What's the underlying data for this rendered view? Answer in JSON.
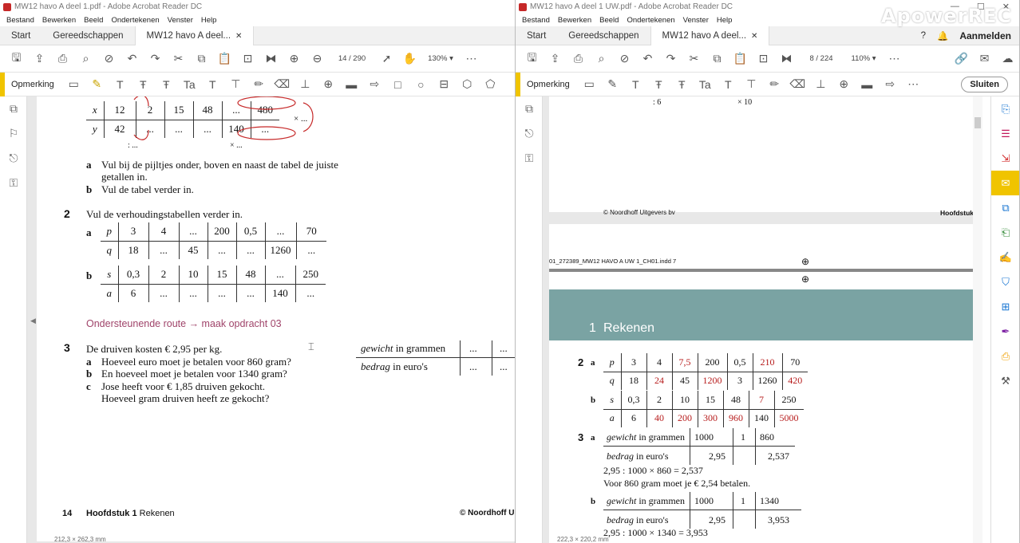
{
  "left": {
    "title": "MW12 havo A deel 1.pdf - Adobe Acrobat Reader DC",
    "menu": [
      "Bestand",
      "Bewerken",
      "Beeld",
      "Ondertekenen",
      "Venster",
      "Help"
    ],
    "tabs": {
      "home": "Start",
      "tools": "Gereedschappen",
      "doc": "MW12 havo A deel..."
    },
    "page_current": "14",
    "page_total": "/ 290",
    "zoom": "130%",
    "ann_label": "Opmerking",
    "content": {
      "above_arrow": ": ...",
      "t1": {
        "x": [
          "x",
          "12",
          "2",
          "15",
          "48",
          "...",
          "480"
        ],
        "y": [
          "y",
          "42",
          "...",
          "...",
          "...",
          "140",
          "..."
        ]
      },
      "t1_right": "× ...",
      "t1_below_left": ": ...",
      "t1_below_right": "× ...",
      "q1a_label": "a",
      "q1a": "Vul bij de pijltjes onder, boven en naast de tabel de juiste",
      "q1a2": "getallen in.",
      "q1b_label": "b",
      "q1b": "Vul de tabel verder in.",
      "q2_num": "2",
      "q2": "Vul de verhoudingstabellen verder in.",
      "q2a_label": "a",
      "t2a": {
        "r1": [
          "p",
          "3",
          "4",
          "...",
          "200",
          "0,5",
          "...",
          "70"
        ],
        "r2": [
          "q",
          "18",
          "...",
          "45",
          "...",
          "...",
          "1260",
          "..."
        ]
      },
      "q2b_label": "b",
      "t2b": {
        "r1": [
          "s",
          "0,3",
          "2",
          "10",
          "15",
          "48",
          "...",
          "250"
        ],
        "r2": [
          "a",
          "6",
          "...",
          "...",
          "...",
          "...",
          "140",
          "..."
        ]
      },
      "route": "Ondersteunende route → maak opdracht 03",
      "q3_num": "3",
      "q3": "De druiven kosten € 2,95 per kg.",
      "q3a_label": "a",
      "q3a": "Hoeveel euro moet je betalen voor 860 gram?",
      "q3b_label": "b",
      "q3b": "En hoeveel moet je betalen voor 1340 gram?",
      "q3c_label": "c",
      "q3c": "Jose heeft voor € 1,85 druiven gekocht.",
      "q3c2": "Hoeveel gram druiven heeft ze gekocht?",
      "gw_label_it": "gewicht",
      "gw_label": " in grammen",
      "bd_label_it": "bedrag",
      "bd_label": " in euro's",
      "dots": "...",
      "footer_num": "14",
      "footer_ch": "Hoofdstuk",
      "footer_ch_num": "1",
      "footer_ch_name": "Rekenen",
      "footer_right": "© Noordhoff Ui",
      "status": "212,3 × 262,3 mm"
    }
  },
  "right": {
    "title": "MW12 havo A deel 1 UW.pdf - Adobe Acrobat Reader DC",
    "menu": [
      "Bestand",
      "Bewerken",
      "Beeld",
      "Ondertekenen",
      "Venster",
      "Help"
    ],
    "tabs": {
      "home": "Start",
      "tools": "Gereedschappen",
      "doc": "MW12 havo A deel..."
    },
    "signin": "Aanmelden",
    "page_current": "8",
    "page_total": "/ 224",
    "zoom": "110%",
    "ann_label": "Opmerking",
    "close": "Sluiten",
    "content": {
      "top_left": ": 6",
      "top_right": "× 10",
      "copyright": "© Noordhoff Uitgevers bv",
      "chapter": "Hoofdstuk",
      "indd": "01_272389_MW12 HAVO A UW 1_CH01.indd   7",
      "banner_num": "1",
      "banner_title": "Rekenen",
      "a2_num": "2",
      "a2a": "a",
      "a2b": "b",
      "t2a": {
        "r1": [
          [
            "p",
            ""
          ],
          [
            "3",
            ""
          ],
          [
            "4",
            ""
          ],
          [
            "7,5",
            "red"
          ],
          [
            "200",
            ""
          ],
          [
            "0,5",
            ""
          ],
          [
            "210",
            "red"
          ],
          [
            "70",
            ""
          ]
        ],
        "r2": [
          [
            "q",
            ""
          ],
          [
            "18",
            ""
          ],
          [
            "24",
            "red"
          ],
          [
            "45",
            ""
          ],
          [
            "1200",
            "red"
          ],
          [
            "3",
            ""
          ],
          [
            "1260",
            ""
          ],
          [
            "420",
            "red"
          ]
        ]
      },
      "t2b": {
        "r1": [
          [
            "s",
            ""
          ],
          [
            "0,3",
            ""
          ],
          [
            "2",
            ""
          ],
          [
            "10",
            ""
          ],
          [
            "15",
            ""
          ],
          [
            "48",
            ""
          ],
          [
            "7",
            "red"
          ],
          [
            "250",
            ""
          ]
        ],
        "r2": [
          [
            "a",
            ""
          ],
          [
            "6",
            ""
          ],
          [
            "40",
            "red"
          ],
          [
            "200",
            "red"
          ],
          [
            "300",
            "red"
          ],
          [
            "960",
            "red"
          ],
          [
            "140",
            ""
          ],
          [
            "5000",
            "red"
          ]
        ]
      },
      "a3_num": "3",
      "a3a": "a",
      "a3b": "b",
      "gw_it": "gewicht",
      "gw": " in grammen",
      "bd_it": "bedrag",
      "bd": " in euro's",
      "t3a": {
        "r1": [
          "1000",
          "1",
          "860"
        ],
        "r2": [
          "2,95",
          "",
          "2,537"
        ]
      },
      "calc_a": "2,95 : 1000 × 860 = 2,537",
      "ans_a": "Voor 860 gram moet je € 2,54 betalen.",
      "t3b": {
        "r1": [
          "1000",
          "1",
          "1340"
        ],
        "r2": [
          "2,95",
          "",
          "3,953"
        ]
      },
      "calc_b": "2,95 : 1000 × 1340 = 3,953",
      "status": "222,3 × 220,2 mm"
    }
  },
  "watermark": "ApowerREC"
}
